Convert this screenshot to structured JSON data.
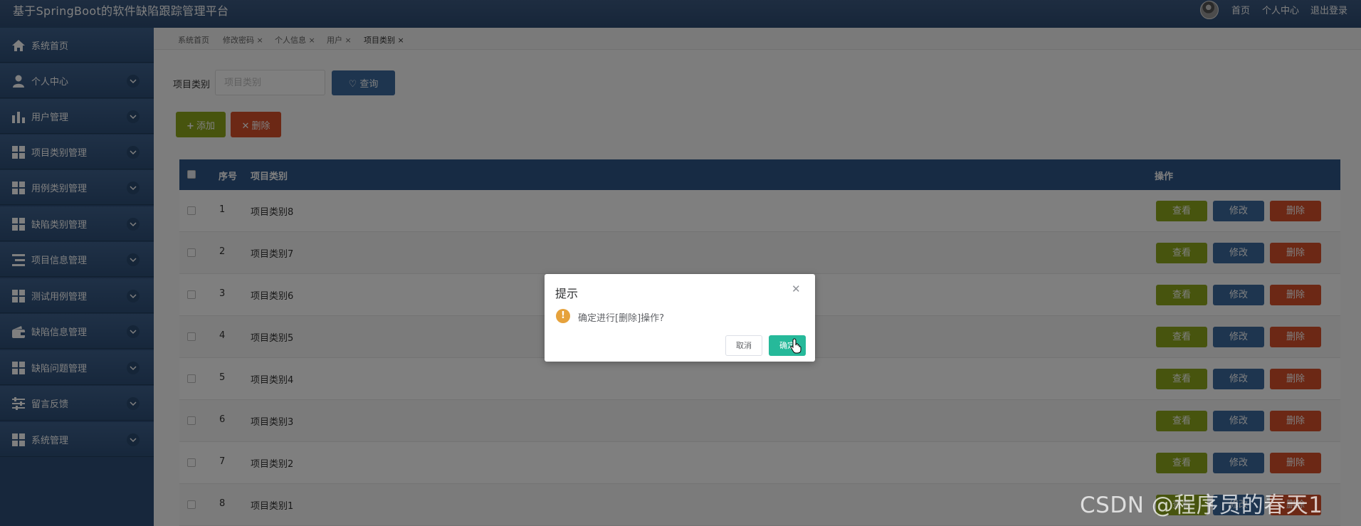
{
  "app": {
    "title": "基于SpringBoot的软件缺陷跟踪管理平台"
  },
  "header": {
    "links": [
      "首页",
      "个人中心",
      "退出登录"
    ]
  },
  "sidebar": {
    "items": [
      {
        "label": "系统首页",
        "icon": "home-icon"
      },
      {
        "label": "个人中心",
        "icon": "user-icon"
      },
      {
        "label": "用户管理",
        "icon": "bar-chart-icon"
      },
      {
        "label": "项目类别管理",
        "icon": "grid-icon"
      },
      {
        "label": "用例类别管理",
        "icon": "grid-icon"
      },
      {
        "label": "缺陷类别管理",
        "icon": "grid-icon"
      },
      {
        "label": "项目信息管理",
        "icon": "list-icon"
      },
      {
        "label": "测试用例管理",
        "icon": "grid-icon"
      },
      {
        "label": "缺陷信息管理",
        "icon": "wallet-icon"
      },
      {
        "label": "缺陷问题管理",
        "icon": "grid-icon"
      },
      {
        "label": "留言反馈",
        "icon": "sliders-icon"
      },
      {
        "label": "系统管理",
        "icon": "grid-icon"
      }
    ]
  },
  "tabs": [
    {
      "label": "系统首页",
      "closable": false
    },
    {
      "label": "修改密码",
      "closable": true
    },
    {
      "label": "个人信息",
      "closable": true
    },
    {
      "label": "用户",
      "closable": true
    },
    {
      "label": "项目类别",
      "closable": true,
      "active": true
    }
  ],
  "search": {
    "label": "项目类别",
    "placeholder": "项目类别",
    "button_label": "查询"
  },
  "actions": {
    "add_label": "添加",
    "delete_label": "删除"
  },
  "table": {
    "columns": [
      "序号",
      "项目类别",
      "操作"
    ],
    "rows": [
      {
        "index": "1",
        "category": "项目类别8"
      },
      {
        "index": "2",
        "category": "项目类别7"
      },
      {
        "index": "3",
        "category": "项目类别6"
      },
      {
        "index": "4",
        "category": "项目类别5"
      },
      {
        "index": "5",
        "category": "项目类别4"
      },
      {
        "index": "6",
        "category": "项目类别3"
      },
      {
        "index": "7",
        "category": "项目类别2"
      },
      {
        "index": "8",
        "category": "项目类别1"
      }
    ],
    "row_actions": {
      "view": "查看",
      "edit": "修改",
      "delete": "删除"
    }
  },
  "dialog": {
    "title": "提示",
    "message": "确定进行[删除]操作?",
    "cancel_label": "取消",
    "confirm_label": "确定"
  },
  "watermark": "CSDN @程序员的春天1",
  "colors": {
    "header": "#2d4c73",
    "sidebar": "#2e4f78",
    "table_header": "#2e5789",
    "view_button": "#8ea91c",
    "edit_button": "#3d6b9f",
    "delete_button": "#d9502a",
    "confirm_button": "#26b99a",
    "warning": "#e6a23c"
  }
}
